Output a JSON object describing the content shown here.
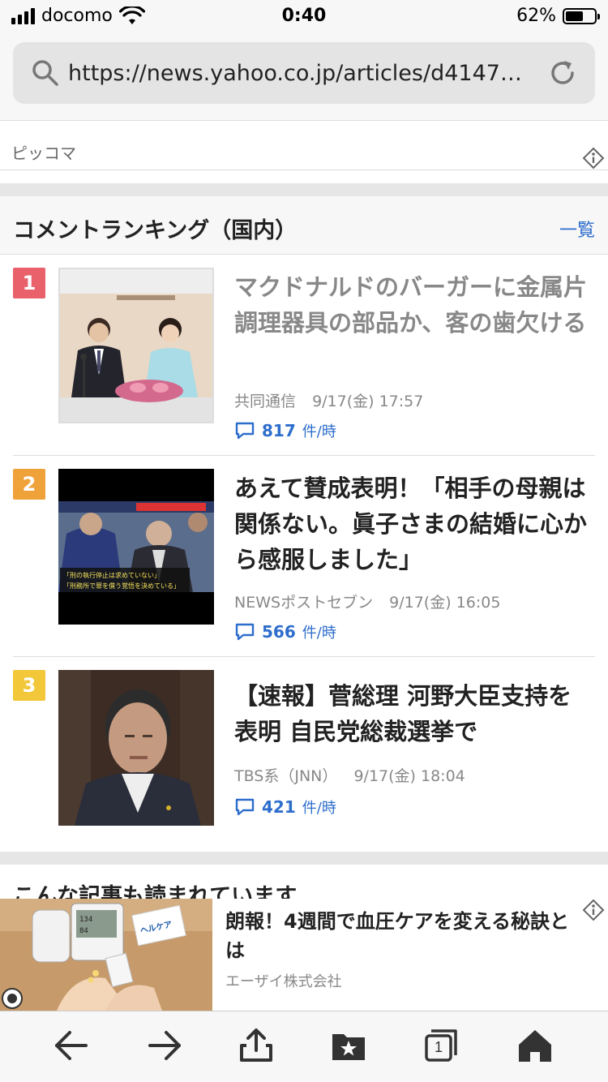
{
  "status": {
    "carrier": "docomo",
    "time": "0:40",
    "battery_pct": "62%",
    "battery_level": 0.62
  },
  "browser": {
    "url": "https://news.yahoo.co.jp/articles/d4147…"
  },
  "promo": {
    "label": "ピッコマ"
  },
  "ranking": {
    "title": "コメントランキング（国内）",
    "more": "一覧",
    "items": [
      {
        "rank": "1",
        "rank_color": "#e8616b",
        "title": "マクドナルドのバーガーに金属片　調理器具の部品か、客の歯欠ける",
        "source": "共同通信",
        "date": "9/17(金) 17:57",
        "comments": "817",
        "unit": "件/時",
        "read": true
      },
      {
        "rank": "2",
        "rank_color": "#f0a23a",
        "title": "あえて賛成表明！「相手の母親は関係ない。眞子さまの結婚に心から感服しました」",
        "source": "NEWSポストセブン",
        "date": "9/17(金) 16:05",
        "comments": "566",
        "unit": "件/時",
        "read": false,
        "thumb_caption_1": "「刑の執行停止は求めていない」",
        "thumb_caption_2": "「刑務所で罪を償う覚悟を決めている」"
      },
      {
        "rank": "3",
        "rank_color": "#f2c83a",
        "title": "【速報】菅総理 河野大臣支持を表明 自民党総裁選挙で",
        "source": "TBS系（JNN）",
        "date": "9/17(金) 18:04",
        "comments": "421",
        "unit": "件/時",
        "read": false
      }
    ]
  },
  "also_read": {
    "title": "こんな記事も読まれています"
  },
  "ad": {
    "title": "朗報！4週間で血圧ケアを変える秘訣とは",
    "sponsor": "エーザイ株式会社",
    "product_label": "ヘルケア"
  },
  "toolbar": {
    "tab_count": "1"
  },
  "colors": {
    "link_blue": "#2d6dcc",
    "read_gray": "#888888"
  }
}
